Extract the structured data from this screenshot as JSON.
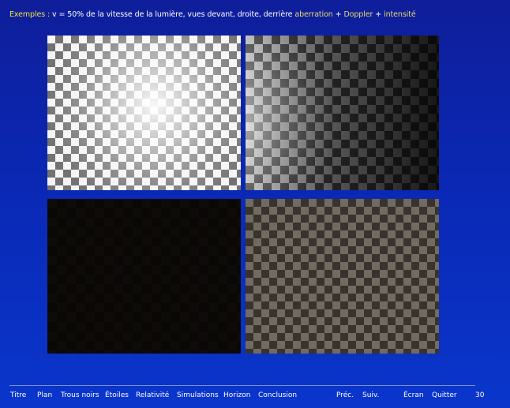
{
  "slide": {
    "title_prefix": "Exemples :",
    "title_main": "v = 50% de la vitesse de la lumière, vues devant, droite, derrière",
    "title_aberration": "aberration",
    "title_plus1": "+",
    "title_doppler": "Doppler",
    "title_plus2": "+",
    "title_intensity": "intensité"
  },
  "nav": {
    "items": [
      "Titre",
      "Plan",
      "Trous noirs",
      "Étoiles",
      "Relativité",
      "Simulations",
      "Horizon",
      "Conclusion"
    ],
    "prev": "Préc.",
    "next": "Suiv.",
    "screen": "Écran",
    "quit": "Quitter",
    "page": "30"
  },
  "colors": {
    "title_yellow": "#f3e23a",
    "background_blue": "#0a28b4"
  }
}
